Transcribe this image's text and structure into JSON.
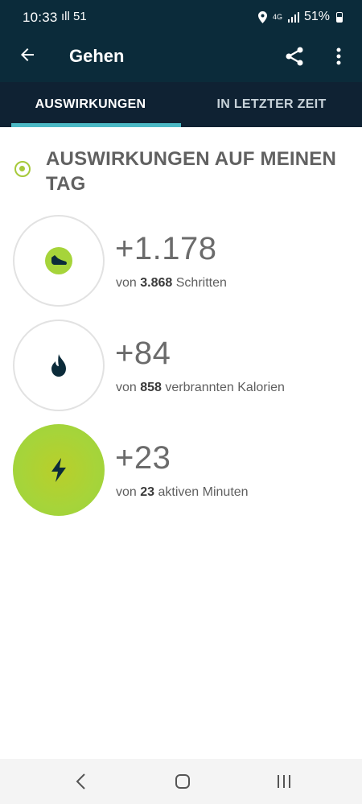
{
  "status_bar": {
    "time": "10:33",
    "left_indicators": "ıll 51",
    "network": "4G",
    "battery": "51%"
  },
  "app_bar": {
    "title": "Gehen"
  },
  "tabs": [
    {
      "label": "AUSWIRKUNGEN",
      "active": true
    },
    {
      "label": "IN LETZTER ZEIT",
      "active": false
    }
  ],
  "section": {
    "title": "AUSWIRKUNGEN AUF MEINEN TAG"
  },
  "metrics": [
    {
      "value": "+1.178",
      "prefix": "von",
      "total": "3.868",
      "unit": "Schritten",
      "icon": "shoe-icon"
    },
    {
      "value": "+84",
      "prefix": "von",
      "total": "858",
      "unit": "verbrannten Kalorien",
      "icon": "flame-icon"
    },
    {
      "value": "+23",
      "prefix": "von",
      "total": "23",
      "unit": "aktiven Minuten",
      "icon": "lightning-icon"
    }
  ],
  "colors": {
    "header_bg": "#0b2b3a",
    "tab_indicator": "#4cb8c4",
    "accent_green": "#a6d43a"
  }
}
